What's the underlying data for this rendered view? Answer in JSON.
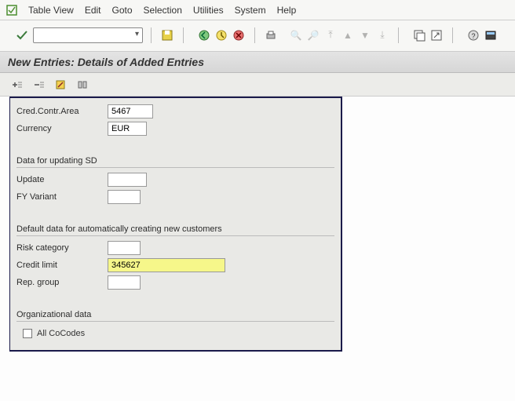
{
  "menu": {
    "items": [
      "Table View",
      "Edit",
      "Goto",
      "Selection",
      "Utilities",
      "System",
      "Help"
    ]
  },
  "title": "New Entries: Details of Added Entries",
  "app_toolbar": {
    "expand_icon": "expand-icon",
    "collapse_icon": "collapse-icon",
    "delimit_icon": "delimit-icon",
    "var_icon": "variable-icon"
  },
  "fields": {
    "cred_contr_area": {
      "label": "Cred.Contr.Area",
      "value": "5467"
    },
    "currency": {
      "label": "Currency",
      "value": "EUR"
    }
  },
  "group1": {
    "title": "Data for updating SD",
    "update": {
      "label": "Update",
      "value": ""
    },
    "fy_variant": {
      "label": "FY Variant",
      "value": ""
    }
  },
  "group2": {
    "title": "Default data for automatically creating new customers",
    "risk_category": {
      "label": "Risk category",
      "value": ""
    },
    "credit_limit": {
      "label": "Credit limit",
      "value": "345627"
    },
    "rep_group": {
      "label": "Rep. group",
      "value": ""
    }
  },
  "group3": {
    "title": "Organizational data",
    "all_cocodes": {
      "label": "All CoCodes",
      "checked": false
    }
  }
}
